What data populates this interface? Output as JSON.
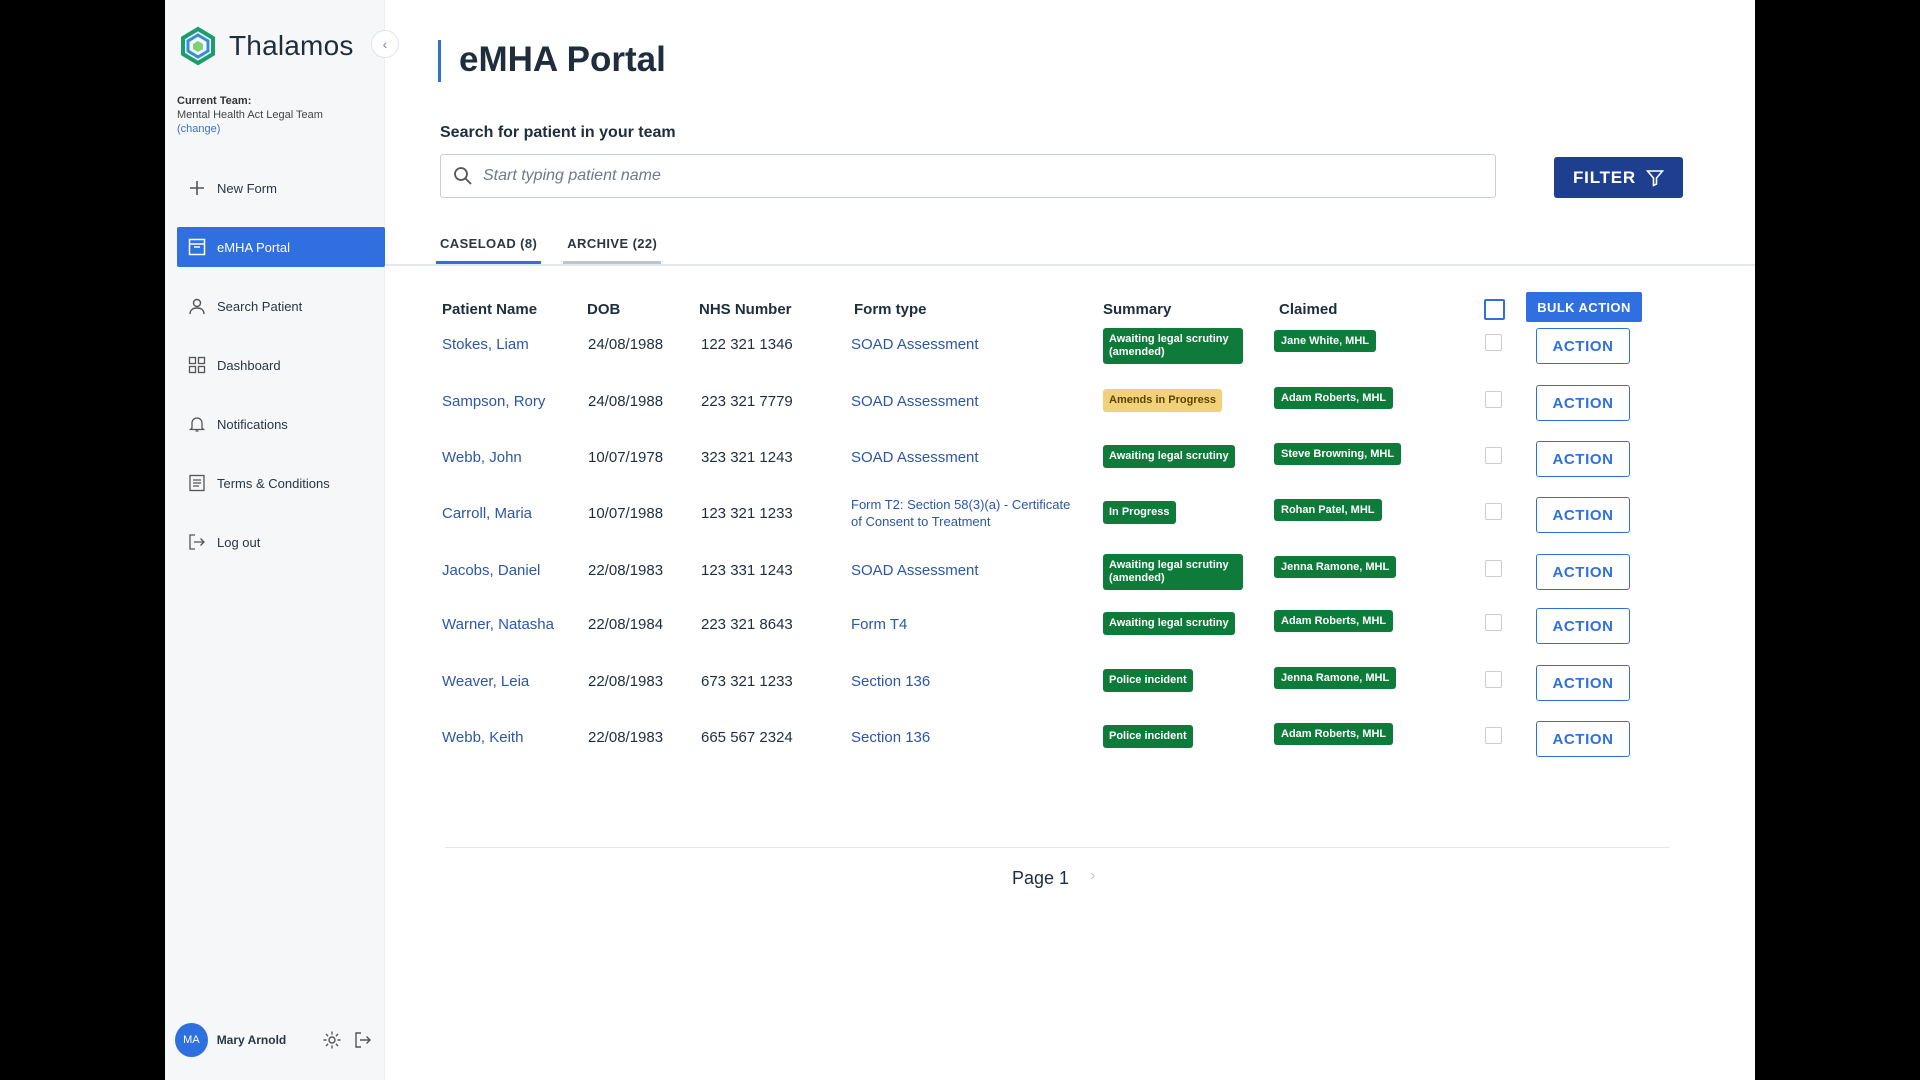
{
  "app": {
    "brand": "Thalamos"
  },
  "team": {
    "label": "Current Team:",
    "name": "Mental Health Act Legal Team",
    "change": "(change)"
  },
  "sidebar": {
    "items": [
      {
        "label": "New Form",
        "icon": "plus-icon"
      },
      {
        "label": "eMHA Portal",
        "icon": "portal-icon",
        "active": true
      },
      {
        "label": "Search Patient",
        "icon": "person-icon"
      },
      {
        "label": "Dashboard",
        "icon": "dashboard-icon"
      },
      {
        "label": "Notifications",
        "icon": "bell-icon"
      },
      {
        "label": "Terms & Conditions",
        "icon": "document-icon"
      },
      {
        "label": "Log out",
        "icon": "logout-icon"
      }
    ]
  },
  "user": {
    "initials": "MA",
    "name": "Mary Arnold"
  },
  "main": {
    "title": "eMHA Portal",
    "search_label": "Search for patient in your team",
    "search_placeholder": "Start typing patient name",
    "filter_label": "FILTER",
    "tabs": [
      {
        "label": "CASELOAD (8)",
        "active": true
      },
      {
        "label": "ARCHIVE (22)",
        "active": false
      }
    ],
    "columns": {
      "name": "Patient Name",
      "dob": "DOB",
      "nhs": "NHS Number",
      "form": "Form type",
      "summary": "Summary",
      "claimed": "Claimed"
    },
    "bulk_action": "BULK ACTION",
    "action_label": "ACTION",
    "rows": [
      {
        "name": "Stokes, Liam",
        "dob": "24/08/1988",
        "nhs": "122 321 1346",
        "form": "SOAD Assessment",
        "summary": "Awaiting legal scrutiny (amended)",
        "summary_color": "#0f7b3a",
        "claimed": "Jane White, MHL"
      },
      {
        "name": "Sampson, Rory",
        "dob": "24/08/1988",
        "nhs": "223 321 7779",
        "form": "SOAD Assessment",
        "summary": "Amends in Progress",
        "summary_color": "#f1d27a",
        "claimed": "Adam Roberts, MHL"
      },
      {
        "name": "Webb, John",
        "dob": "10/07/1978",
        "nhs": "323 321 1243",
        "form": "SOAD Assessment",
        "summary": "Awaiting legal scrutiny",
        "summary_color": "#0f7b3a",
        "claimed": "Steve Browning, MHL"
      },
      {
        "name": "Carroll, Maria",
        "dob": "10/07/1988",
        "nhs": "123 321 1233",
        "form": "Form T2: Section 58(3)(a) - Certificate of Consent to Treatment",
        "summary": "In Progress",
        "summary_color": "#0f7b3a",
        "claimed": "Rohan Patel, MHL"
      },
      {
        "name": "Jacobs, Daniel",
        "dob": "22/08/1983",
        "nhs": "123 331 1243",
        "form": "SOAD Assessment",
        "summary": "Awaiting legal scrutiny (amended)",
        "summary_color": "#0f7b3a",
        "claimed": "Jenna Ramone, MHL"
      },
      {
        "name": "Warner, Natasha",
        "dob": "22/08/1984",
        "nhs": "223 321 8643",
        "form": "Form T4",
        "summary": "Awaiting legal scrutiny",
        "summary_color": "#0f7b3a",
        "claimed": "Adam Roberts, MHL"
      },
      {
        "name": "Weaver, Leia",
        "dob": "22/08/1983",
        "nhs": "673 321 1233",
        "form": "Section 136",
        "summary": "Police incident",
        "summary_color": "#0f7b3a",
        "claimed": "Jenna Ramone, MHL"
      },
      {
        "name": "Webb, Keith",
        "dob": "22/08/1983",
        "nhs": "665 567 2324",
        "form": "Section 136",
        "summary": "Police incident",
        "summary_color": "#0f7b3a",
        "claimed": "Adam Roberts, MHL"
      }
    ],
    "pager": {
      "label": "Page 1",
      "next": "›"
    }
  },
  "colors": {
    "accent": "#2f6fe0",
    "navy": "#1e3f8f",
    "status_green": "#0f7b3a",
    "status_amber": "#f1d27a"
  }
}
